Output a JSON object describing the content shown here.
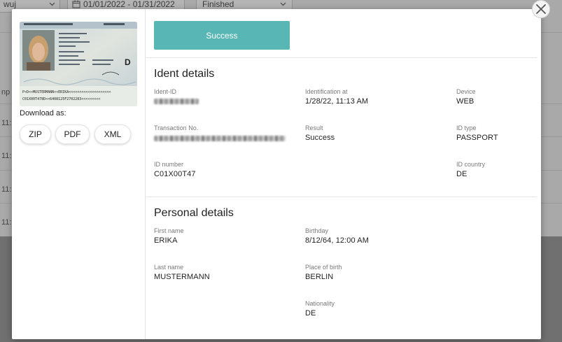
{
  "background": {
    "filter_left_value": "wuj",
    "date_range": "01/01/2022 - 01/31/2022",
    "status_filter": "Finished",
    "column_fragment": "np",
    "row_time_fragments": [
      "11:",
      "11:",
      "11:",
      "11:"
    ]
  },
  "download": {
    "label": "Download as:",
    "buttons": [
      "ZIP",
      "PDF",
      "XML"
    ]
  },
  "status_button": "Success",
  "ident_details": {
    "title": "Ident details",
    "ident_id_label": "Ident-ID",
    "identification_at_label": "Identification at",
    "identification_at_value": "1/28/22, 11:13 AM",
    "device_label": "Device",
    "device_value": "WEB",
    "transaction_label": "Transaction No.",
    "result_label": "Result",
    "result_value": "Success",
    "id_type_label": "ID type",
    "id_type_value": "PASSPORT",
    "id_number_label": "ID number",
    "id_number_value": "C01X00T47",
    "id_country_label": "ID country",
    "id_country_value": "DE"
  },
  "personal_details": {
    "title": "Personal details",
    "first_name_label": "First name",
    "first_name_value": "ERIKA",
    "birthday_label": "Birthday",
    "birthday_value": "8/12/64, 12:00 AM",
    "last_name_label": "Last name",
    "last_name_value": "MUSTERMANN",
    "place_of_birth_label": "Place of birth",
    "place_of_birth_value": "BERLIN",
    "nationality_label": "Nationality",
    "nationality_value": "DE"
  },
  "icons": {
    "close": "close-icon",
    "calendar": "calendar-icon",
    "chevron": "chevron-down-icon"
  },
  "colors": {
    "success_accent": "#58b7b5"
  }
}
